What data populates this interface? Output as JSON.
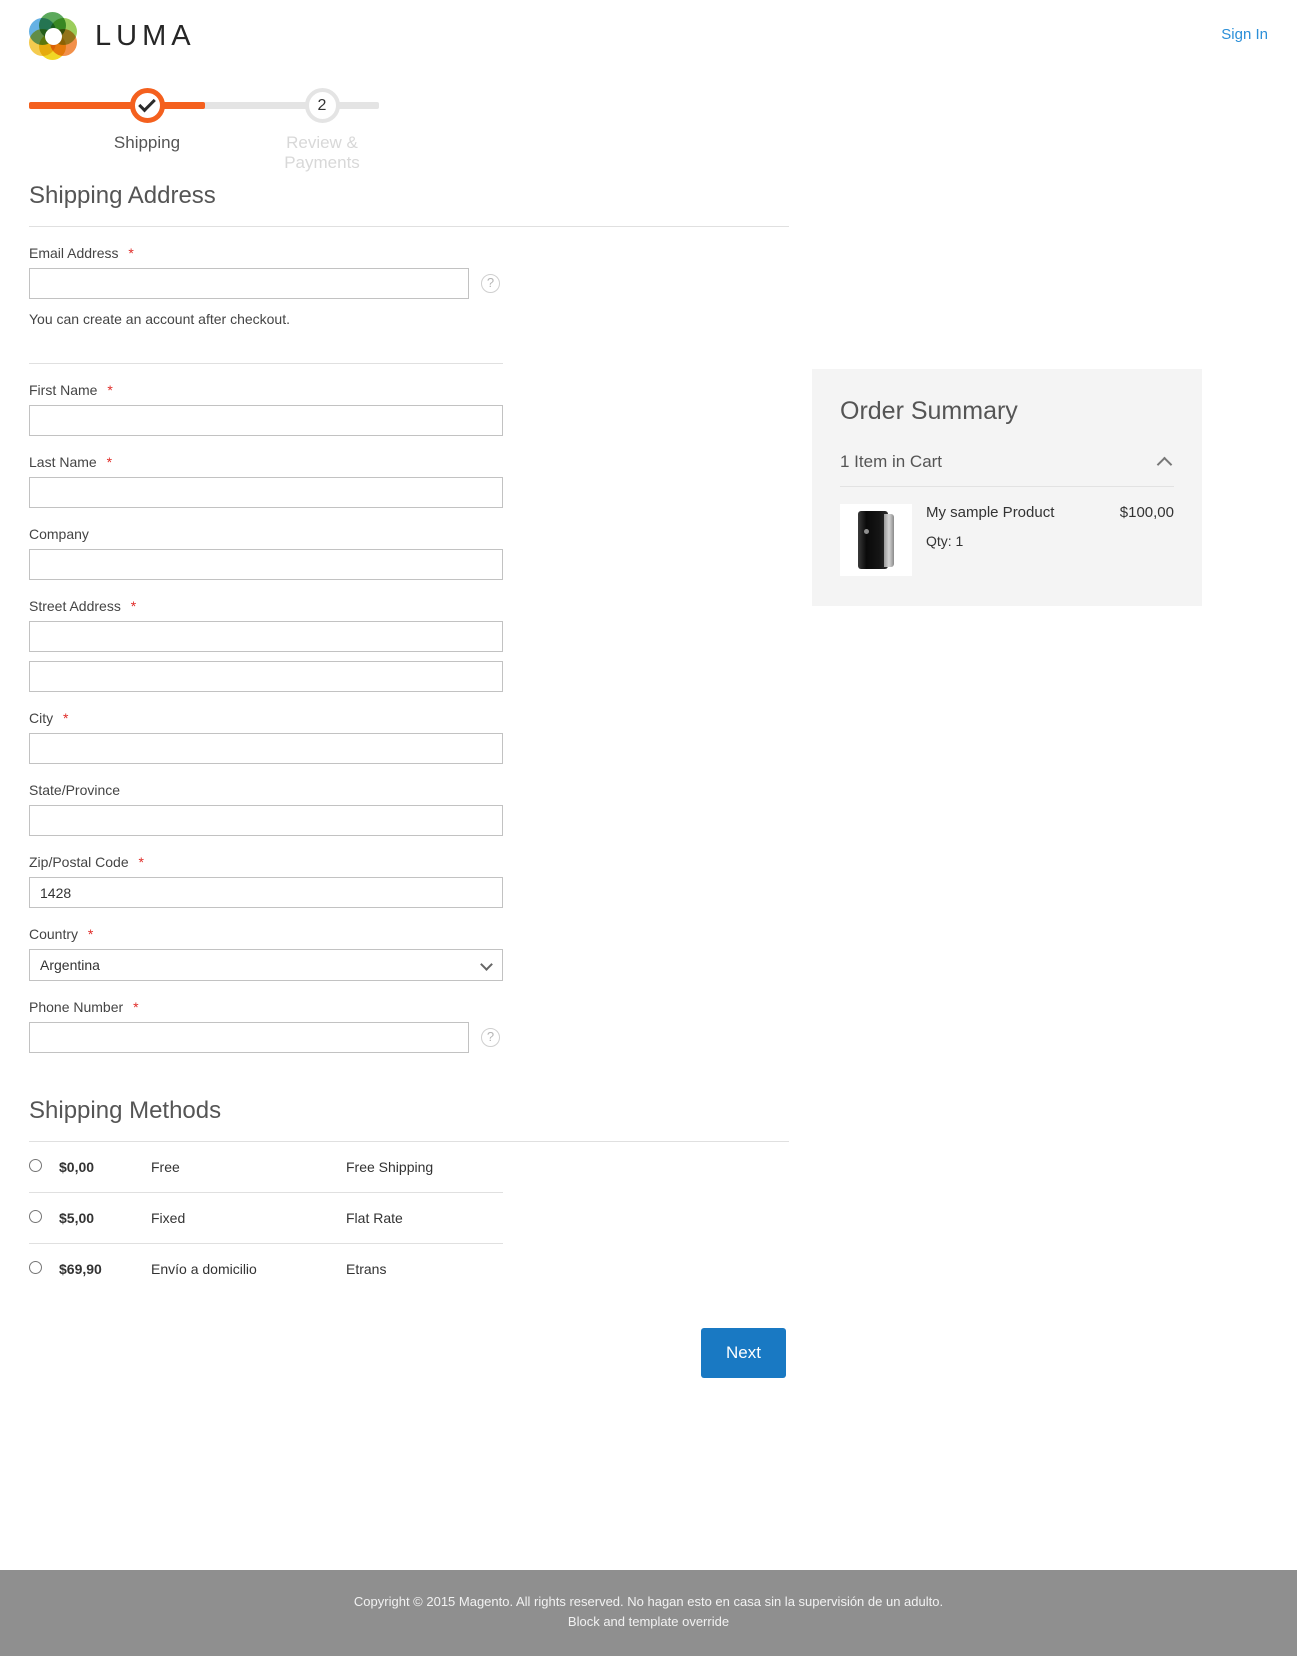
{
  "header": {
    "brand": "LUMA",
    "sign_in_label": "Sign In",
    "logo_icon": "luma-flower-logo"
  },
  "progress": {
    "steps": [
      {
        "label": "Shipping",
        "badge": "✓",
        "state": "complete"
      },
      {
        "label": "Review & Payments",
        "badge": "2",
        "state": "upcoming"
      }
    ],
    "active_color": "#f4601e",
    "inactive_color": "#e4e4e4"
  },
  "shipping_address": {
    "title": "Shipping Address",
    "email": {
      "label": "Email Address",
      "required": "*",
      "value": "",
      "placeholder": "",
      "tooltip_icon": "help-circle-icon",
      "note": "You can create an account after checkout."
    },
    "first_name": {
      "label": "First Name",
      "required": "*",
      "value": "",
      "placeholder": ""
    },
    "last_name": {
      "label": "Last Name",
      "required": "*",
      "value": "",
      "placeholder": ""
    },
    "company": {
      "label": "Company",
      "required": "",
      "value": "",
      "placeholder": ""
    },
    "street": {
      "label": "Street Address",
      "required": "*",
      "line1_value": "",
      "line2_value": "",
      "placeholder": ""
    },
    "city": {
      "label": "City",
      "required": "*",
      "value": "",
      "placeholder": ""
    },
    "state": {
      "label": "State/Province",
      "required": "",
      "value": "",
      "placeholder": ""
    },
    "zip": {
      "label": "Zip/Postal Code",
      "required": "*",
      "value": "1428",
      "placeholder": ""
    },
    "country": {
      "label": "Country",
      "required": "*",
      "value": "Argentina",
      "options": [
        "Argentina"
      ],
      "caret_icon": "chevron-down-icon"
    },
    "phone": {
      "label": "Phone Number",
      "required": "*",
      "value": "",
      "placeholder": "",
      "tooltip_icon": "help-circle-icon"
    }
  },
  "shipping_methods": {
    "title": "Shipping Methods",
    "rows": [
      {
        "price": "$0,00",
        "method": "Free",
        "carrier": "Free Shipping",
        "selected": false
      },
      {
        "price": "$5,00",
        "method": "Fixed",
        "carrier": "Flat Rate",
        "selected": false
      },
      {
        "price": "$69,90",
        "method": "Envío a domicilio",
        "carrier": "Etrans",
        "selected": false
      }
    ]
  },
  "actions": {
    "next_label": "Next",
    "next_color": "#1979c3"
  },
  "order_summary": {
    "title": "Order Summary",
    "cart_count_label": "1 Item in Cart",
    "toggle_icon": "chevron-up-icon",
    "items": [
      {
        "name": "My sample Product",
        "qty_label": "Qty: 1",
        "price": "$100,00",
        "thumb_icon": "product-thumbnail"
      }
    ]
  },
  "footer": {
    "line1": "Copyright © 2015 Magento. All rights reserved. No hagan esto en casa sin la supervisión de un adulto.",
    "line2": "Block and template override"
  }
}
